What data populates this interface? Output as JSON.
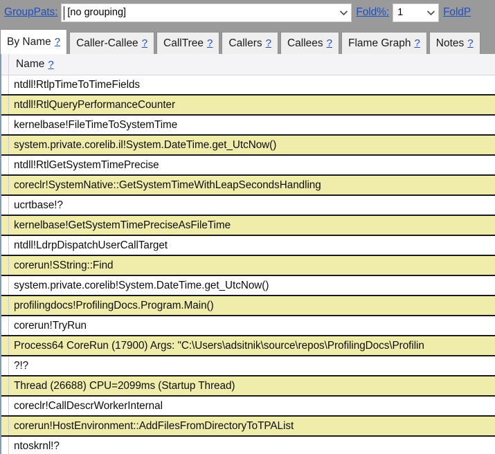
{
  "toolbar": {
    "grouppats_label": "GroupPats:",
    "grouppats_value": "[no grouping]",
    "grouppats_placeholder": "[no grouping]",
    "foldpct_label": "Fold%:",
    "foldpct_value": "1",
    "foldpat_label": "FoldP",
    "caret_icon": "chevron-down-icon"
  },
  "tabs": [
    {
      "label": "By Name",
      "help": "?",
      "selected": true
    },
    {
      "label": "Caller-Callee",
      "help": "?",
      "selected": false
    },
    {
      "label": "CallTree",
      "help": "?",
      "selected": false
    },
    {
      "label": "Callers",
      "help": "?",
      "selected": false
    },
    {
      "label": "Callees",
      "help": "?",
      "selected": false
    },
    {
      "label": "Flame Graph",
      "help": "?",
      "selected": false
    },
    {
      "label": "Notes",
      "help": "?",
      "selected": false
    }
  ],
  "grid": {
    "columns": [
      {
        "label": "Name",
        "help": "?"
      }
    ],
    "rows": [
      {
        "name": "ntdll!RtlpTimeToTimeFields",
        "highlight": false
      },
      {
        "name": "ntdll!RtlQueryPerformanceCounter",
        "highlight": true
      },
      {
        "name": "kernelbase!FileTimeToSystemTime",
        "highlight": false
      },
      {
        "name": "system.private.corelib.il!System.DateTime.get_UtcNow()",
        "highlight": true
      },
      {
        "name": "ntdll!RtlGetSystemTimePrecise",
        "highlight": false
      },
      {
        "name": "coreclr!SystemNative::GetSystemTimeWithLeapSecondsHandling",
        "highlight": true
      },
      {
        "name": "ucrtbase!?",
        "highlight": false
      },
      {
        "name": "kernelbase!GetSystemTimePreciseAsFileTime",
        "highlight": true
      },
      {
        "name": "ntdll!LdrpDispatchUserCallTarget",
        "highlight": false
      },
      {
        "name": "corerun!SString::Find",
        "highlight": true
      },
      {
        "name": "system.private.corelib!System.DateTime.get_UtcNow()",
        "highlight": false
      },
      {
        "name": "profilingdocs!ProfilingDocs.Program.Main()",
        "highlight": true
      },
      {
        "name": "corerun!TryRun",
        "highlight": false
      },
      {
        "name": "Process64 CoreRun (17900) Args:  \"C:\\Users\\adsitnik\\source\\repos\\ProfilingDocs\\Profilin",
        "highlight": true
      },
      {
        "name": "?!?",
        "highlight": false
      },
      {
        "name": "Thread (26688) CPU=2099ms (Startup Thread)",
        "highlight": true
      },
      {
        "name": "coreclr!CallDescrWorkerInternal",
        "highlight": false
      },
      {
        "name": "corerun!HostEnvironment::AddFilesFromDirectoryToTPAList",
        "highlight": true
      },
      {
        "name": "ntoskrnl!?",
        "highlight": false
      }
    ]
  },
  "colors": {
    "toolbar_bg": "#9a9a9a",
    "highlight_row": "#f0edaa",
    "link": "#1b4fc4",
    "header_bg": "#f4f4f6",
    "row_separator": "#1a1a1a"
  }
}
